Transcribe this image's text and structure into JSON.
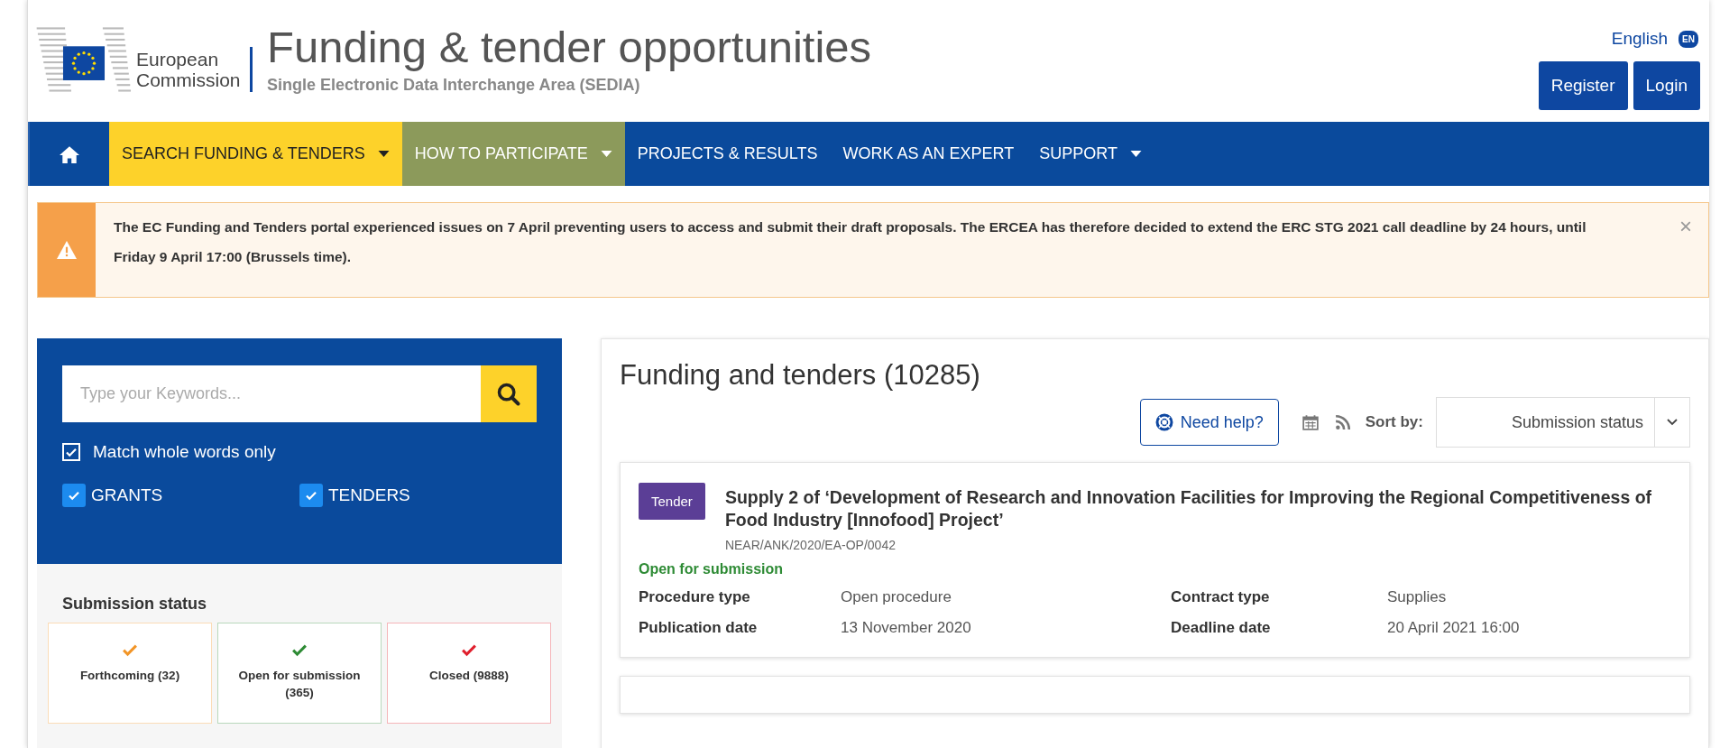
{
  "header": {
    "org": "European Commission",
    "title": "Funding & tender opportunities",
    "subtitle": "Single Electronic Data Interchange Area (SEDIA)",
    "language": "English",
    "language_code": "EN",
    "buttons": [
      "Register",
      "Login"
    ]
  },
  "nav": [
    {
      "label": "SEARCH FUNDING & TENDERS",
      "dropdown": true,
      "color": "#fdd22a"
    },
    {
      "label": "HOW TO PARTICIPATE",
      "dropdown": true,
      "color": "#8c9a5b"
    },
    {
      "label": "PROJECTS & RESULTS",
      "dropdown": false
    },
    {
      "label": "WORK AS AN EXPERT",
      "dropdown": false
    },
    {
      "label": "SUPPORT",
      "dropdown": true
    }
  ],
  "alert": {
    "text": "The EC Funding and Tenders portal experienced issues on 7 April preventing users to access and submit their draft proposals. The ERCEA has therefore decided to extend the ERC STG 2021 call deadline by 24 hours, until Friday 9 April 17:00 (Brussels time).",
    "close": "×"
  },
  "search": {
    "placeholder": "Type your Keywords...",
    "match_whole_words": {
      "label": "Match whole words only",
      "checked": true
    },
    "types": [
      {
        "label": "GRANTS",
        "checked": true
      },
      {
        "label": "TENDERS",
        "checked": true
      }
    ]
  },
  "submission_status": {
    "title": "Submission status",
    "options": [
      {
        "label": "Forthcoming (32)",
        "color": "#f29527"
      },
      {
        "label": "Open for submission (365)",
        "color": "#2e8b35"
      },
      {
        "label": "Closed (9888)",
        "color": "#e0202e"
      }
    ]
  },
  "results": {
    "title": "Funding and tenders (10285)",
    "help": "Need help?",
    "sort_label": "Sort by:",
    "sort_value": "Submission status",
    "items": [
      {
        "type": "Tender",
        "title": "Supply 2 of ‘Development of Research and Innovation Facilities for Improving the Regional Competitiveness of Food Industry [Innofood] Project’",
        "reference": "NEAR/ANK/2020/EA-OP/0042",
        "status": "Open for submission",
        "fields": [
          {
            "label": "Procedure type",
            "value": "Open procedure"
          },
          {
            "label": "Contract type",
            "value": "Supplies"
          },
          {
            "label": "Publication date",
            "value": "13 November 2020"
          },
          {
            "label": "Deadline date",
            "value": "20 April 2021 16:00"
          }
        ]
      }
    ]
  }
}
